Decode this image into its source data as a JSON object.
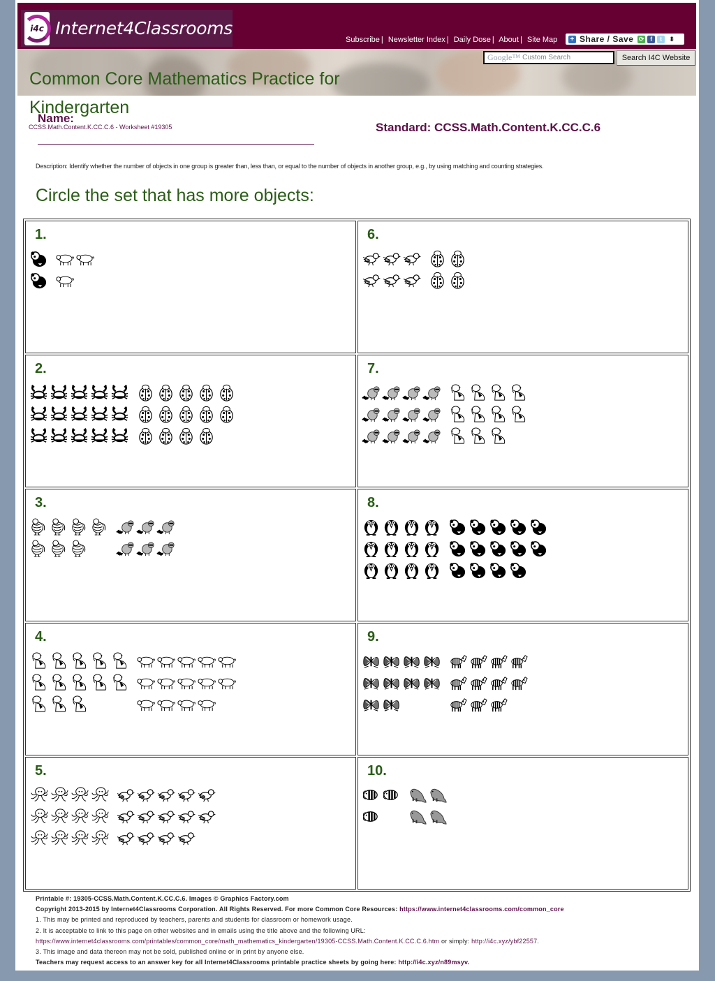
{
  "header": {
    "logo_badge": "i4c",
    "logo_text": "Internet4Classrooms",
    "nav": [
      "Subscribe",
      "Newsletter Index",
      "Daily Dose",
      "About",
      "Site Map"
    ],
    "share_label": "Share / Save",
    "search_placeholder_brand": "Google™",
    "search_placeholder": "Custom Search",
    "search_button": "Search I4C Website"
  },
  "page": {
    "title": "Common Core Mathematics Practice for Kindergarten",
    "name_label": "Name:",
    "worksheet_id": "CCSS.Math.Content.K.CC.C.6 - Worksheet #19305",
    "standard": "Standard: CCSS.Math.Content.K.CC.C.6",
    "description": "Description: Identify whether the number of objects in one group is greater than, less than, or equal to the number of objects in another group, e.g., by using matching and counting strategies.",
    "instruction": "Circle the set that has more objects:"
  },
  "problems": [
    {
      "number": "1.",
      "sets": [
        {
          "animal": "panda",
          "count": 2,
          "cols": 1
        },
        {
          "animal": "pig",
          "count": 3,
          "cols": 2
        }
      ]
    },
    {
      "number": "6.",
      "sets": [
        {
          "animal": "bird",
          "count": 6,
          "cols": 3
        },
        {
          "animal": "ladybug",
          "count": 4,
          "cols": 2
        }
      ]
    },
    {
      "number": "2.",
      "sets": [
        {
          "animal": "crab",
          "count": 15,
          "cols": 5
        },
        {
          "animal": "ladybug",
          "count": 14,
          "cols": 5
        }
      ]
    },
    {
      "number": "7.",
      "sets": [
        {
          "animal": "raccoon",
          "count": 12,
          "cols": 4
        },
        {
          "animal": "dog",
          "count": 11,
          "cols": 4
        }
      ]
    },
    {
      "number": "3.",
      "sets": [
        {
          "animal": "chicken",
          "count": 7,
          "cols": 4
        },
        {
          "animal": "raccoon",
          "count": 6,
          "cols": 3
        }
      ]
    },
    {
      "number": "8.",
      "sets": [
        {
          "animal": "penguin",
          "count": 12,
          "cols": 4
        },
        {
          "animal": "panda",
          "count": 14,
          "cols": 5
        }
      ]
    },
    {
      "number": "4.",
      "sets": [
        {
          "animal": "dog",
          "count": 13,
          "cols": 5
        },
        {
          "animal": "pig",
          "count": 14,
          "cols": 5
        }
      ]
    },
    {
      "number": "9.",
      "sets": [
        {
          "animal": "butterfly",
          "count": 10,
          "cols": 4
        },
        {
          "animal": "zebra",
          "count": 11,
          "cols": 4
        }
      ]
    },
    {
      "number": "5.",
      "sets": [
        {
          "animal": "octopus",
          "count": 12,
          "cols": 4
        },
        {
          "animal": "bird",
          "count": 14,
          "cols": 5
        }
      ]
    },
    {
      "number": "10.",
      "sets": [
        {
          "animal": "fish",
          "count": 3,
          "cols": 2
        },
        {
          "animal": "seal",
          "count": 4,
          "cols": 2
        }
      ]
    }
  ],
  "footer": {
    "printable": "Printable #: 19305-CCSS.Math.Content.K.CC.C.6. Images © Graphics Factory.com",
    "copyright": "Copyright 2013-2015 by Internet4Classrooms Corporation. All Rights Reserved. For more Common Core Resources: ",
    "copyright_link": "https://www.internet4classrooms.com/common_core",
    "note1": "1. This may be printed and reproduced by teachers, parents and students for classroom or homework usage.",
    "note2": "2. It is acceptable to link to this page on other websites and in emails using the title above and the following URL:",
    "url_long": "https://www.internet4classrooms.com/printables/common_core/math_mathematics_kindergarten/19305-CCSS.Math.Content.K.CC.C.6.htm",
    "or_simply": " or simply: ",
    "url_short": "http://i4c.xyz/ybf22557",
    "note3": "3. This image and data thereon may not be sold, published online or in print by anyone else.",
    "answer_key": "Teachers may request access to an answer key for all Internet4Classrooms printable practice sheets by going here: ",
    "answer_key_link": "http://i4c.xyz/n89msyv"
  }
}
